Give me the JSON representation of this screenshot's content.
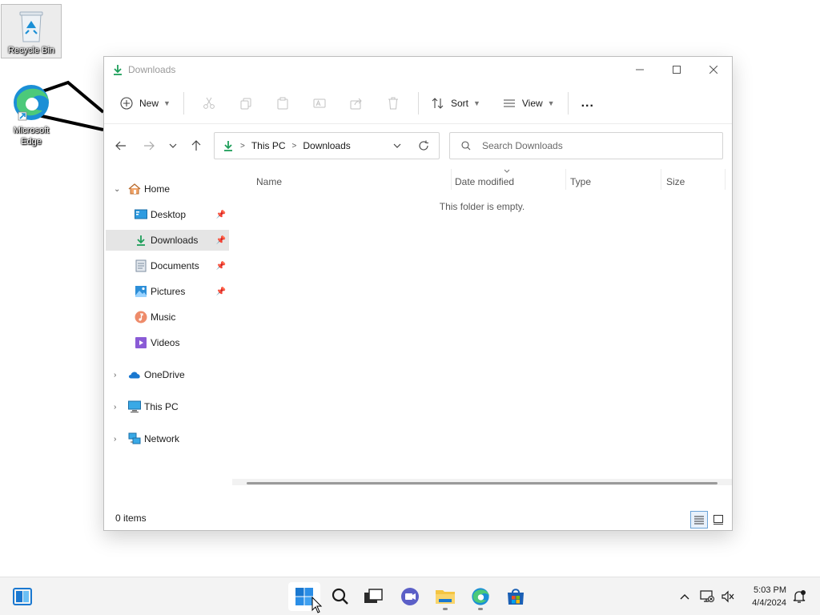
{
  "desktop": {
    "icons": [
      {
        "label": "Recycle Bin"
      },
      {
        "label": "Microsoft Edge"
      }
    ]
  },
  "window": {
    "title": "Downloads",
    "toolbar": {
      "new_label": "New",
      "sort_label": "Sort",
      "view_label": "View",
      "more_label": "..."
    },
    "address": {
      "crumbs": [
        "This PC",
        "Downloads"
      ]
    },
    "search": {
      "placeholder": "Search Downloads"
    },
    "sidebar": {
      "items": [
        {
          "label": "Home",
          "icon": "home-icon"
        },
        {
          "label": "Desktop",
          "icon": "desktop-icon"
        },
        {
          "label": "Downloads",
          "icon": "download-icon"
        },
        {
          "label": "Documents",
          "icon": "documents-icon"
        },
        {
          "label": "Pictures",
          "icon": "pictures-icon"
        },
        {
          "label": "Music",
          "icon": "music-icon"
        },
        {
          "label": "Videos",
          "icon": "videos-icon"
        },
        {
          "label": "OneDrive",
          "icon": "onedrive-icon"
        },
        {
          "label": "This PC",
          "icon": "this-pc-icon"
        },
        {
          "label": "Network",
          "icon": "network-icon"
        }
      ]
    },
    "columns": [
      "Name",
      "Date modified",
      "Type",
      "Size"
    ],
    "empty_message": "This folder is empty.",
    "status": "0 items"
  },
  "taskbar": {
    "time": "5:03 PM",
    "date": "4/4/2024"
  },
  "colors": {
    "accent": "#0067c0",
    "download_green": "#1e9e5a",
    "folder_yellow": "#f4c542"
  }
}
